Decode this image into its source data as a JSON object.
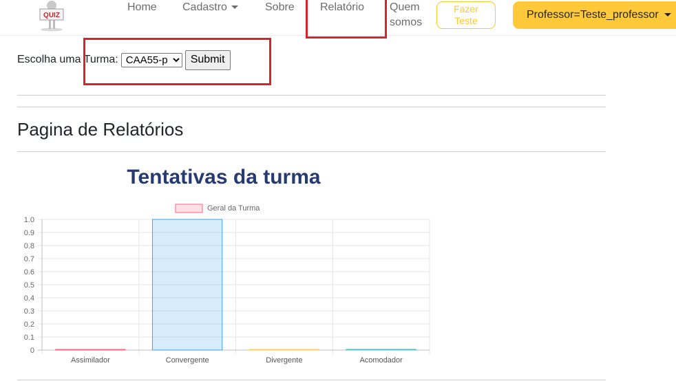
{
  "navbar": {
    "logo_text": "QUIZ",
    "links": {
      "home": "Home",
      "cadastro": "Cadastro",
      "sobre": "Sobre",
      "relatorio": "Relatório",
      "quem_line1": "Quem",
      "quem_line2": "somos"
    },
    "fazer_line1": "Fazer",
    "fazer_line2": "Teste",
    "professor": "Professor=Teste_professor"
  },
  "form": {
    "label": "Escolha uma Turma:",
    "selected_turma": "CAA55-p",
    "submit_label": "Submit"
  },
  "page_title": "Pagina de Relatórios",
  "chart_title": "Tentativas da turma",
  "colors": {
    "accent": "#ffc93a",
    "highlight": "#d8232a",
    "chart_title": "#253a73"
  },
  "chart_data": {
    "type": "bar",
    "categories": [
      "Assimilador",
      "Convergente",
      "Divergente",
      "Acomodador"
    ],
    "series": [
      {
        "name": "Geral da Turma",
        "values": [
          0,
          1,
          0,
          0
        ]
      }
    ],
    "bar_colors": [
      "#ff6384",
      "#36a2eb",
      "#ffce56",
      "#4bc0c0"
    ],
    "ylim": [
      0,
      1.0
    ],
    "yticks": [
      "0",
      "0.1",
      "0.2",
      "0.3",
      "0.4",
      "0.5",
      "0.6",
      "0.7",
      "0.8",
      "0.9",
      "1.0"
    ],
    "grid": true,
    "legend_position": "top"
  }
}
